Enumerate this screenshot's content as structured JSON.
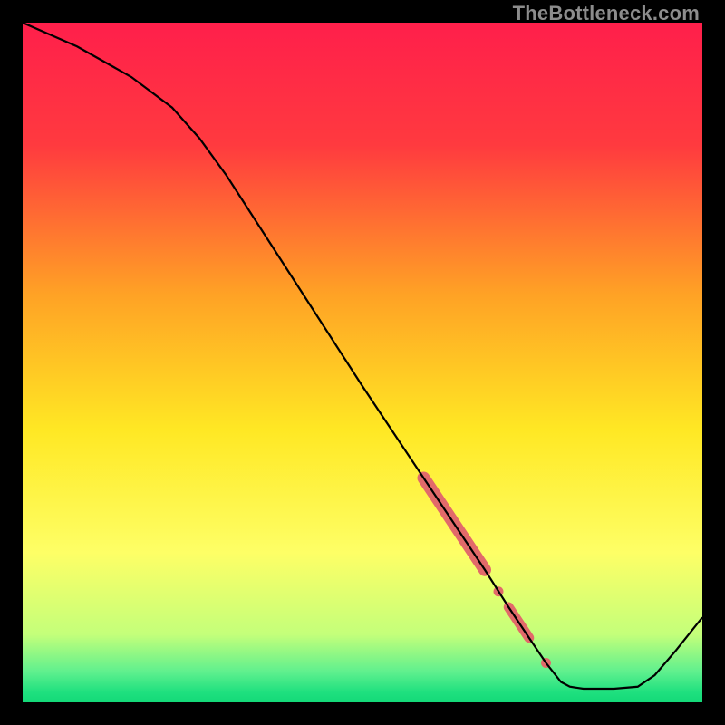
{
  "watermark": "TheBottleneck.com",
  "chart_data": {
    "type": "line",
    "title": "",
    "xlabel": "",
    "ylabel": "",
    "xlim": [
      0,
      100
    ],
    "ylim": [
      0,
      100
    ],
    "gradient_stops": [
      {
        "pos": 0.0,
        "color": "#ff1f4b"
      },
      {
        "pos": 0.18,
        "color": "#ff3a3f"
      },
      {
        "pos": 0.4,
        "color": "#ffa225"
      },
      {
        "pos": 0.6,
        "color": "#ffe824"
      },
      {
        "pos": 0.78,
        "color": "#feff66"
      },
      {
        "pos": 0.9,
        "color": "#c4ff7a"
      },
      {
        "pos": 0.955,
        "color": "#5ff08e"
      },
      {
        "pos": 0.985,
        "color": "#1fe07f"
      },
      {
        "pos": 1.0,
        "color": "#14d978"
      }
    ],
    "series": [
      {
        "name": "bottleneck-curve",
        "color": "#000000",
        "width": 2.2,
        "points": [
          {
            "x": 0.0,
            "y": 100.0
          },
          {
            "x": 8.0,
            "y": 96.5
          },
          {
            "x": 16.0,
            "y": 92.0
          },
          {
            "x": 22.0,
            "y": 87.5
          },
          {
            "x": 26.0,
            "y": 83.0
          },
          {
            "x": 30.0,
            "y": 77.5
          },
          {
            "x": 40.0,
            "y": 62.0
          },
          {
            "x": 50.0,
            "y": 46.5
          },
          {
            "x": 59.0,
            "y": 33.0
          },
          {
            "x": 63.0,
            "y": 27.0
          },
          {
            "x": 68.0,
            "y": 19.5
          },
          {
            "x": 71.5,
            "y": 14.0
          },
          {
            "x": 74.5,
            "y": 9.5
          },
          {
            "x": 77.0,
            "y": 5.8
          },
          {
            "x": 79.2,
            "y": 3.0
          },
          {
            "x": 80.5,
            "y": 2.3
          },
          {
            "x": 82.5,
            "y": 2.0
          },
          {
            "x": 87.0,
            "y": 2.0
          },
          {
            "x": 90.5,
            "y": 2.3
          },
          {
            "x": 93.0,
            "y": 4.0
          },
          {
            "x": 96.0,
            "y": 7.5
          },
          {
            "x": 100.0,
            "y": 12.5
          }
        ]
      }
    ],
    "highlights": {
      "color": "#e26a6a",
      "segments": [
        {
          "x1": 59.0,
          "y1": 33.0,
          "x2": 68.0,
          "y2": 19.5,
          "width": 14
        },
        {
          "x1": 71.5,
          "y1": 14.0,
          "x2": 74.5,
          "y2": 9.5,
          "width": 11
        }
      ],
      "dots": [
        {
          "x": 70.0,
          "y": 16.3,
          "r": 5.5
        },
        {
          "x": 77.0,
          "y": 5.8,
          "r": 5.5
        }
      ]
    }
  }
}
